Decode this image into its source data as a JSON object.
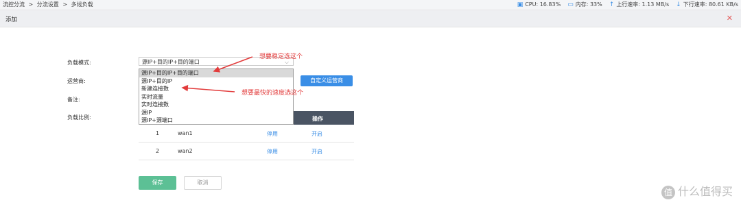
{
  "breadcrumb": {
    "items": [
      "流控分流",
      ">",
      "分流设置",
      ">",
      "多线负载"
    ]
  },
  "status": {
    "cpu": "CPU: 16.83%",
    "memory": "内存: 33%",
    "upload": "上行速率: 1.13 MB/s",
    "download": "下行速率: 80.61 KB/s"
  },
  "dialog": {
    "title": "添加",
    "close_icon": "close-icon"
  },
  "form": {
    "mode_label": "负载模式:",
    "isp_label": "运营商:",
    "note_label": "备注:",
    "ratio_label": "负载比例:",
    "mode_selected": "源IP+目的IP+目的端口",
    "mode_options": [
      "源IP+目的IP+目的端口",
      "源IP+目的IP",
      "新建连接数",
      "实时流量",
      "实时连接数",
      "源IP",
      "源IP+源端口"
    ],
    "custom_isp_button": "自定义运营商"
  },
  "table": {
    "header_operation": "操作",
    "rows": [
      {
        "index": "1",
        "name": "wan1",
        "disable": "停用",
        "enable": "开启"
      },
      {
        "index": "2",
        "name": "wan2",
        "disable": "停用",
        "enable": "开启"
      }
    ]
  },
  "buttons": {
    "save": "保存",
    "cancel": "取消"
  },
  "annotations": {
    "stable": "想要稳定选这个",
    "fastest": "想要最快的速度选这个"
  },
  "watermark": {
    "text": "什么值得买",
    "logo_text": "值"
  },
  "colors": {
    "accent": "#3a8ee6",
    "save": "#5cc095",
    "table_header": "#4a5463",
    "annotation": "#e23b3b",
    "close": "#e35a5a"
  }
}
